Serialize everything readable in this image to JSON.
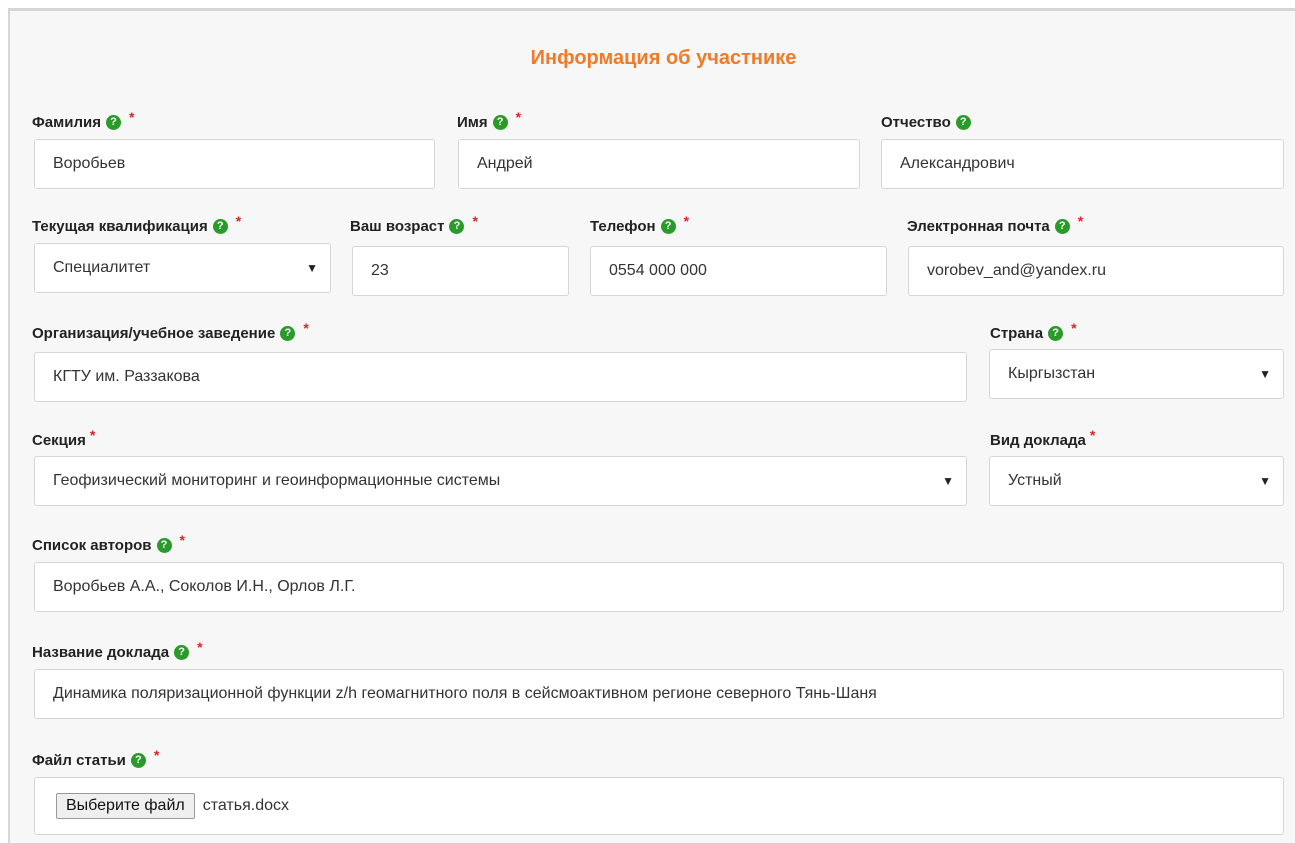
{
  "form": {
    "title": "Информация об участнике",
    "help_glyph": "?",
    "required_mark": "*",
    "last_name": {
      "label": "Фамилия",
      "value": "Воробьев"
    },
    "first_name": {
      "label": "Имя",
      "value": "Андрей"
    },
    "patronymic": {
      "label": "Отчество",
      "value": "Александрович"
    },
    "qualification": {
      "label": "Текущая квалификация",
      "value": "Специалитет"
    },
    "age": {
      "label": "Ваш возраст",
      "value": "23"
    },
    "phone": {
      "label": "Телефон",
      "value": "0554 000 000"
    },
    "email": {
      "label": "Электронная почта",
      "value": "vorobev_and@yandex.ru"
    },
    "organization": {
      "label": "Организация/учебное заведение",
      "value": "КГТУ им. Раззакова"
    },
    "country": {
      "label": "Страна",
      "value": "Кыргызстан"
    },
    "section": {
      "label": "Секция",
      "value": "Геофизический мониторинг и геоинформационные системы"
    },
    "report_type": {
      "label": "Вид доклада",
      "value": "Устный"
    },
    "authors": {
      "label": "Список авторов",
      "value": "Воробьев А.А., Соколов И.Н., Орлов Л.Г."
    },
    "report_title": {
      "label": "Название доклада",
      "value": "Динамика поляризационной функции z/h геомагнитного поля в сейсмоактивном регионе северного Тянь-Шаня"
    },
    "article_file": {
      "label": "Файл статьи",
      "button": "Выберите файл",
      "file_name": "статья.docx"
    }
  },
  "colors": {
    "title": "#f07a26",
    "required": "#d9242a",
    "help_icon": "#2a9a2a",
    "panel_bg": "#f7f7f7"
  },
  "icons": {
    "help": "question-circle-icon",
    "dropdown": "caret-down-icon"
  }
}
